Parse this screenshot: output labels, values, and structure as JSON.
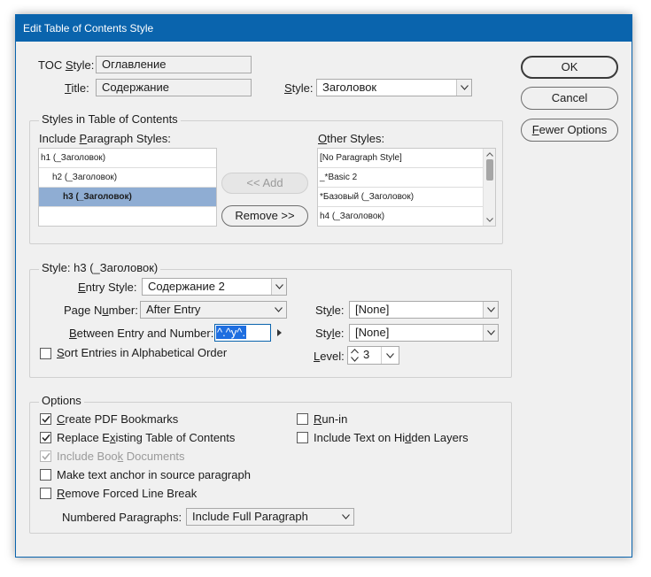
{
  "window": {
    "title": "Edit Table of Contents Style"
  },
  "top": {
    "toc_style_label": "TOC Style:",
    "toc_style_value": "Оглавление",
    "title_label": "Title:",
    "title_value": "Содержание",
    "style_label": "Style:",
    "style_value": "Заголовок"
  },
  "buttons": {
    "ok": "OK",
    "cancel": "Cancel",
    "fewer_options": "Fewer Options",
    "add": "<< Add",
    "remove": "Remove >>"
  },
  "styles_in_toc": {
    "group_title": "Styles in Table of Contents",
    "include_label": "Include Paragraph Styles:",
    "include_items": [
      {
        "label": "h1 (_Заголовок)",
        "selected": false
      },
      {
        "label": "h2 (_Заголовок)",
        "selected": false
      },
      {
        "label": "h3 (_Заголовок)",
        "selected": true
      }
    ],
    "other_label": "Other Styles:",
    "other_items": [
      "[No Paragraph Style]",
      "_*Basic 2",
      "*Базовый (_Заголовок)",
      "h4 (_Заголовок)"
    ]
  },
  "style_section": {
    "group_title": "Style: h3 (_Заголовок)",
    "entry_style_label": "Entry Style:",
    "entry_style_value": "Содержание 2",
    "page_number_label": "Page Number:",
    "page_number_value": "After Entry",
    "between_label": "Between Entry and Number:",
    "between_value": "^.^y^.",
    "style1_label": "Style:",
    "style1_value": "[None]",
    "style2_label": "Style:",
    "style2_value": "[None]",
    "sort_label": "Sort Entries in Alphabetical Order",
    "sort_checked": false,
    "level_label": "Level:",
    "level_value": "3"
  },
  "options": {
    "group_title": "Options",
    "create_pdf_bookmarks": {
      "label": "Create PDF Bookmarks",
      "checked": true
    },
    "replace_existing": {
      "label": "Replace Existing Table of Contents",
      "checked": true
    },
    "include_book": {
      "label": "Include Book Documents",
      "checked": true,
      "disabled": true
    },
    "make_text_anchor": {
      "label": "Make text anchor in source paragraph",
      "checked": false
    },
    "remove_forced": {
      "label": "Remove Forced Line Break",
      "checked": false
    },
    "run_in": {
      "label": "Run-in",
      "checked": false
    },
    "include_hidden": {
      "label": "Include Text on Hidden Layers",
      "checked": false
    },
    "numbered_label": "Numbered Paragraphs:",
    "numbered_value": "Include Full Paragraph"
  },
  "colors": {
    "titlebar": "#0a64ad",
    "selection": "#8fadd3",
    "text_highlight": "#1e6ee0"
  }
}
